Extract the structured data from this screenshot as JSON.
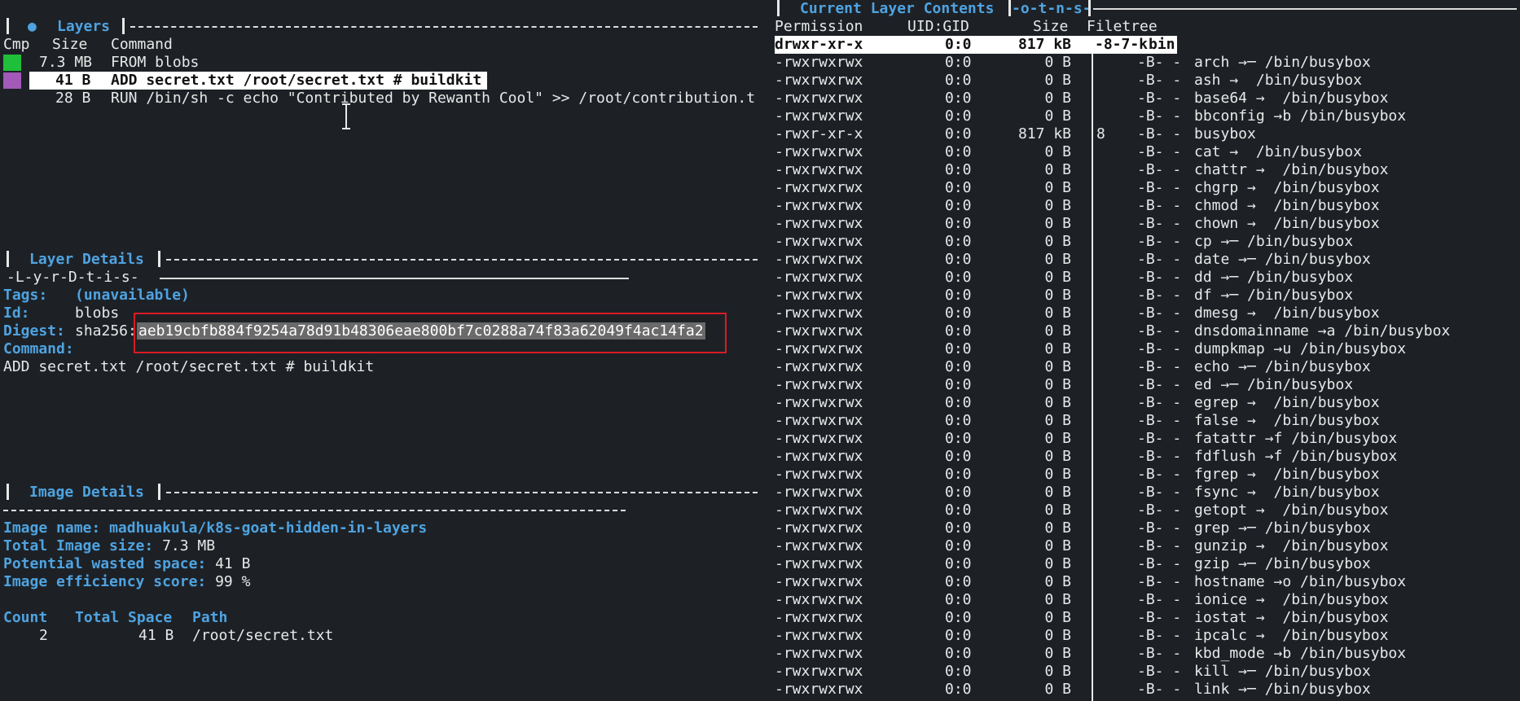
{
  "layers": {
    "title": "Layers",
    "headers": {
      "cmp": "Cmp",
      "size": "Size",
      "command": "Command"
    },
    "rows": [
      {
        "size": "7.3 MB",
        "command": "FROM blobs",
        "color": "#1fbf3a"
      },
      {
        "size": "41 B",
        "command": "ADD secret.txt /root/secret.txt # buildkit",
        "color": "#a259b8",
        "selected": true
      },
      {
        "size": "28 B",
        "command": "RUN /bin/sh -c echo \"Contributed by Rewanth Cool\" >> /root/contribution.t"
      }
    ]
  },
  "layer_details": {
    "title": "Layer Details",
    "subtitle": "-L-y-r-D-t-i-s-",
    "tags_label": "Tags:",
    "tags_value": "(unavailable)",
    "id_label": "Id:",
    "id_value": "blobs",
    "digest_label": "Digest:",
    "digest_prefix": "sha256:",
    "digest_value": "aeb19cbfb884f9254a78d91b48306eae800bf7c0288a74f83a62049f4ac14fa2",
    "command_label": "Command:",
    "command_value": "ADD secret.txt /root/secret.txt # buildkit"
  },
  "image_details": {
    "title": "Image Details",
    "name_label": "Image name:",
    "name_value": "madhuakula/k8s-goat-hidden-in-layers",
    "size_label": "Total Image size:",
    "size_value": "7.3 MB",
    "wasted_label": "Potential wasted space:",
    "wasted_value": "41 B",
    "efficiency_label": "Image efficiency score:",
    "efficiency_value": "99 %",
    "table_headers": {
      "count": "Count",
      "total": "Total Space",
      "path": "Path"
    },
    "table_rows": [
      {
        "count": "2",
        "total": "41 B",
        "path": "/root/secret.txt"
      }
    ]
  },
  "contents": {
    "title": "Current Layer Contents",
    "title_suffix": "-o-t-n-s-",
    "headers": {
      "permission": "Permission",
      "uid": "UID:GID",
      "size": "Size",
      "filetree": "Filetree"
    },
    "selected_row": {
      "perm": "drwxr-xr-x",
      "uid": "0:0",
      "size": "817 kB",
      "tree": "-8-7-k",
      "name": "bin"
    },
    "rows": [
      {
        "perm": "-rwxrwxrwx",
        "uid": "0:0",
        "size": "0 B",
        "tree": "-B- -",
        "name": "arch →─ /bin/busybox"
      },
      {
        "perm": "-rwxrwxrwx",
        "uid": "0:0",
        "size": "0 B",
        "tree": "-B- -",
        "name": "ash →  /bin/busybox"
      },
      {
        "perm": "-rwxrwxrwx",
        "uid": "0:0",
        "size": "0 B",
        "tree": "-B- -",
        "name": "base64 →  /bin/busybox"
      },
      {
        "perm": "-rwxrwxrwx",
        "uid": "0:0",
        "size": "0 B",
        "tree": "-B- -",
        "name": "bbconfig →b /bin/busybox"
      },
      {
        "perm": "-rwxr-xr-x",
        "uid": "0:0",
        "size": "817 kB",
        "extra": "8",
        "tree": "-B- -",
        "name": "busybox"
      },
      {
        "perm": "-rwxrwxrwx",
        "uid": "0:0",
        "size": "0 B",
        "tree": "-B- -",
        "name": "cat →  /bin/busybox"
      },
      {
        "perm": "-rwxrwxrwx",
        "uid": "0:0",
        "size": "0 B",
        "tree": "-B- -",
        "name": "chattr →  /bin/busybox"
      },
      {
        "perm": "-rwxrwxrwx",
        "uid": "0:0",
        "size": "0 B",
        "tree": "-B- -",
        "name": "chgrp →  /bin/busybox"
      },
      {
        "perm": "-rwxrwxrwx",
        "uid": "0:0",
        "size": "0 B",
        "tree": "-B- -",
        "name": "chmod →  /bin/busybox"
      },
      {
        "perm": "-rwxrwxrwx",
        "uid": "0:0",
        "size": "0 B",
        "tree": "-B- -",
        "name": "chown →  /bin/busybox"
      },
      {
        "perm": "-rwxrwxrwx",
        "uid": "0:0",
        "size": "0 B",
        "tree": "-B- -",
        "name": "cp →─ /bin/busybox"
      },
      {
        "perm": "-rwxrwxrwx",
        "uid": "0:0",
        "size": "0 B",
        "tree": "-B- -",
        "name": "date →─ /bin/busybox"
      },
      {
        "perm": "-rwxrwxrwx",
        "uid": "0:0",
        "size": "0 B",
        "tree": "-B- -",
        "name": "dd →─ /bin/busybox"
      },
      {
        "perm": "-rwxrwxrwx",
        "uid": "0:0",
        "size": "0 B",
        "tree": "-B- -",
        "name": "df →─ /bin/busybox"
      },
      {
        "perm": "-rwxrwxrwx",
        "uid": "0:0",
        "size": "0 B",
        "tree": "-B- -",
        "name": "dmesg →  /bin/busybox"
      },
      {
        "perm": "-rwxrwxrwx",
        "uid": "0:0",
        "size": "0 B",
        "tree": "-B- -",
        "name": "dnsdomainname →a /bin/busybox"
      },
      {
        "perm": "-rwxrwxrwx",
        "uid": "0:0",
        "size": "0 B",
        "tree": "-B- -",
        "name": "dumpkmap →u /bin/busybox"
      },
      {
        "perm": "-rwxrwxrwx",
        "uid": "0:0",
        "size": "0 B",
        "tree": "-B- -",
        "name": "echo →─ /bin/busybox"
      },
      {
        "perm": "-rwxrwxrwx",
        "uid": "0:0",
        "size": "0 B",
        "tree": "-B- -",
        "name": "ed →─ /bin/busybox"
      },
      {
        "perm": "-rwxrwxrwx",
        "uid": "0:0",
        "size": "0 B",
        "tree": "-B- -",
        "name": "egrep →  /bin/busybox"
      },
      {
        "perm": "-rwxrwxrwx",
        "uid": "0:0",
        "size": "0 B",
        "tree": "-B- -",
        "name": "false →  /bin/busybox"
      },
      {
        "perm": "-rwxrwxrwx",
        "uid": "0:0",
        "size": "0 B",
        "tree": "-B- -",
        "name": "fatattr →f /bin/busybox"
      },
      {
        "perm": "-rwxrwxrwx",
        "uid": "0:0",
        "size": "0 B",
        "tree": "-B- -",
        "name": "fdflush →f /bin/busybox"
      },
      {
        "perm": "-rwxrwxrwx",
        "uid": "0:0",
        "size": "0 B",
        "tree": "-B- -",
        "name": "fgrep →  /bin/busybox"
      },
      {
        "perm": "-rwxrwxrwx",
        "uid": "0:0",
        "size": "0 B",
        "tree": "-B- -",
        "name": "fsync →  /bin/busybox"
      },
      {
        "perm": "-rwxrwxrwx",
        "uid": "0:0",
        "size": "0 B",
        "tree": "-B- -",
        "name": "getopt →  /bin/busybox"
      },
      {
        "perm": "-rwxrwxrwx",
        "uid": "0:0",
        "size": "0 B",
        "tree": "-B- -",
        "name": "grep →─ /bin/busybox"
      },
      {
        "perm": "-rwxrwxrwx",
        "uid": "0:0",
        "size": "0 B",
        "tree": "-B- -",
        "name": "gunzip →  /bin/busybox"
      },
      {
        "perm": "-rwxrwxrwx",
        "uid": "0:0",
        "size": "0 B",
        "tree": "-B- -",
        "name": "gzip →─ /bin/busybox"
      },
      {
        "perm": "-rwxrwxrwx",
        "uid": "0:0",
        "size": "0 B",
        "tree": "-B- -",
        "name": "hostname →o /bin/busybox"
      },
      {
        "perm": "-rwxrwxrwx",
        "uid": "0:0",
        "size": "0 B",
        "tree": "-B- -",
        "name": "ionice →  /bin/busybox"
      },
      {
        "perm": "-rwxrwxrwx",
        "uid": "0:0",
        "size": "0 B",
        "tree": "-B- -",
        "name": "iostat →  /bin/busybox"
      },
      {
        "perm": "-rwxrwxrwx",
        "uid": "0:0",
        "size": "0 B",
        "tree": "-B- -",
        "name": "ipcalc →  /bin/busybox"
      },
      {
        "perm": "-rwxrwxrwx",
        "uid": "0:0",
        "size": "0 B",
        "tree": "-B- -",
        "name": "kbd_mode →b /bin/busybox"
      },
      {
        "perm": "-rwxrwxrwx",
        "uid": "0:0",
        "size": "0 B",
        "tree": "-B- -",
        "name": "kill →─ /bin/busybox"
      },
      {
        "perm": "-rwxrwxrwx",
        "uid": "0:0",
        "size": "0 B",
        "tree": "-B- -",
        "name": "link →─ /bin/busybox"
      }
    ]
  }
}
